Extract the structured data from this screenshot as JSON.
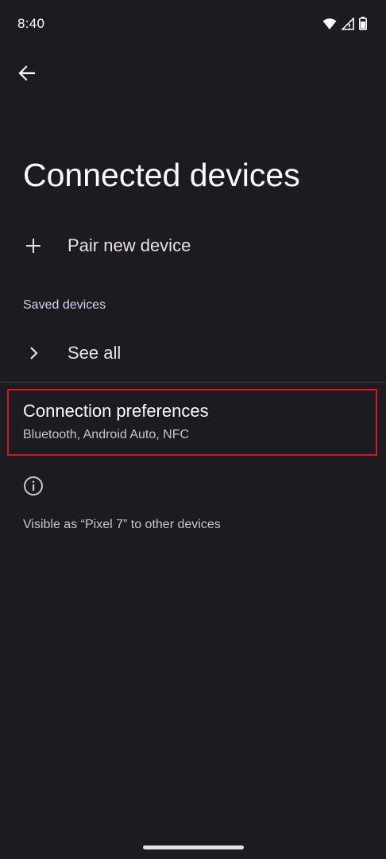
{
  "status_bar": {
    "time": "8:40",
    "icons": [
      "wifi-icon",
      "cell-signal-icon",
      "battery-icon"
    ]
  },
  "header": {
    "back_icon": "arrow-back-icon",
    "title": "Connected devices"
  },
  "pair_new_device": {
    "icon": "plus-icon",
    "label": "Pair new device"
  },
  "saved_devices": {
    "header": "Saved devices",
    "see_all": {
      "icon": "chevron-right-icon",
      "label": "See all"
    }
  },
  "connection_preferences": {
    "title": "Connection preferences",
    "summary": "Bluetooth, Android Auto, NFC",
    "highlight_color": "#d5161c"
  },
  "footer": {
    "icon": "info-icon",
    "text": "Visible as “Pixel 7” to other devices"
  },
  "colors": {
    "background": "#1c1b20",
    "accent_header": "#d6d0f0"
  }
}
